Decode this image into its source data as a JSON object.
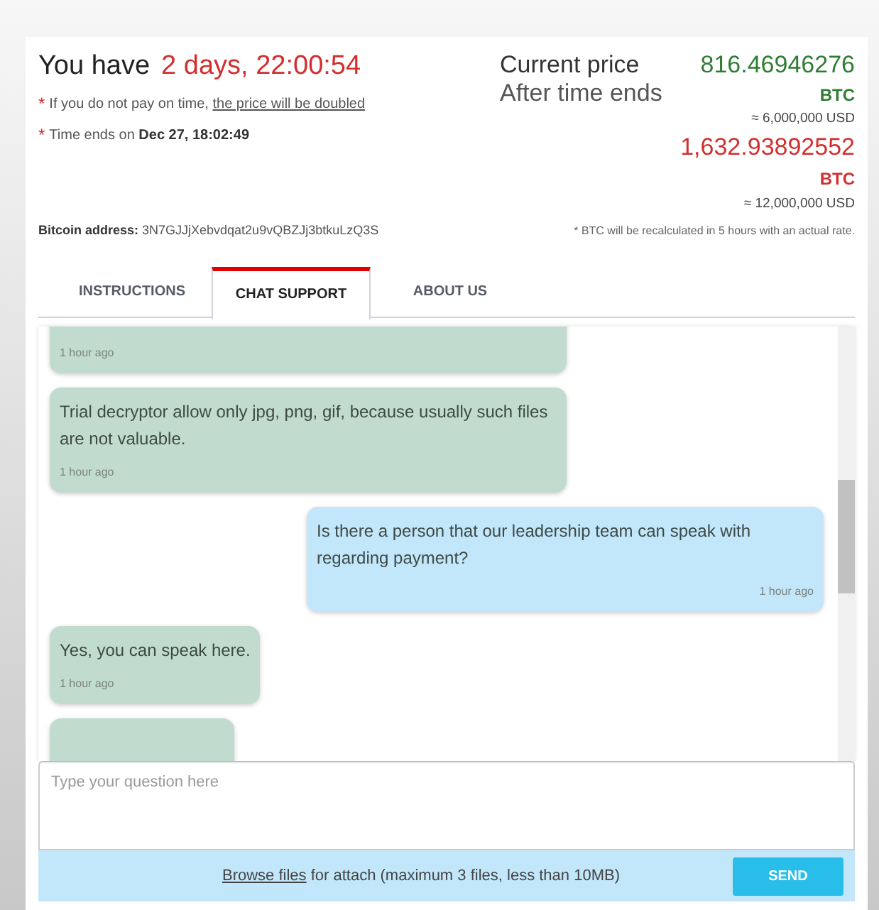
{
  "header": {
    "countdown_label": "You have",
    "countdown": "2 days, 22:00:54",
    "notes": [
      {
        "marker": "*",
        "text": "If you do not pay on time, ",
        "link": "the price will be doubled"
      },
      {
        "marker": "*",
        "text": "Time ends on ",
        "strong": "Dec 27, 18:02:49"
      }
    ],
    "bitcoin_address_label": "Bitcoin address:",
    "bitcoin_address": "3N7GJJjXebvdqat2u9vQBZJj3btkuLzQ3S"
  },
  "prices": [
    {
      "label": "Current price",
      "amount": "816.46946276",
      "currency": "BTC",
      "usd": "≈ 6,000,000 USD",
      "color": "#2e7d32"
    },
    {
      "label": "After time ends",
      "amount": "1,632.93892552",
      "currency": "BTC",
      "usd": "≈ 12,000,000 USD",
      "color": "#d32f2f"
    }
  ],
  "recalc_note": "* BTC will be recalculated in 5 hours with an actual rate.",
  "tabs": [
    {
      "label": "INSTRUCTIONS",
      "selected": false
    },
    {
      "label": "CHAT SUPPORT",
      "selected": true
    },
    {
      "label": "ABOUT US",
      "selected": false
    }
  ],
  "messages": [
    {
      "kind": "incoming",
      "time": "1 hour ago"
    },
    {
      "kind": "incoming",
      "text": "Trial decryptor allow only jpg, png, gif, because usually such files are not valuable.",
      "time": "1 hour ago"
    },
    {
      "kind": "outgoing",
      "text": "Is there a person that our leadership team can speak with regarding payment?",
      "time": "1 hour ago"
    },
    {
      "kind": "incoming",
      "text": "Yes, you can speak here.",
      "time": "1 hour ago"
    },
    {
      "kind": "incoming"
    }
  ],
  "composer": {
    "placeholder": "Type your question here",
    "browse_link": "Browse files",
    "attach_note": " for attach (maximum 3 files, less than 10MB)",
    "send": "SEND"
  }
}
